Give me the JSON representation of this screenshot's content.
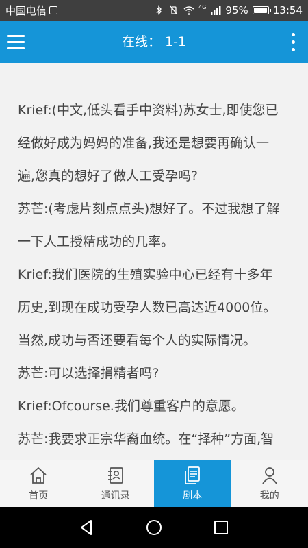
{
  "status_bar": {
    "carrier": "中国电信",
    "network": "4G",
    "battery": "95%",
    "battery_level": 0.95,
    "time": "13:54"
  },
  "app_bar": {
    "title": "在线： 1-1",
    "menu_icon": "hamburger-menu-icon",
    "more_icon": "more-vertical-icon"
  },
  "script": {
    "lines": [
      "Krief:(中文,低头看手中资料)苏女士,即使您已",
      "经做好成为妈妈的准备,我还是想要再确认一",
      "遍,您真的想好了做人工受孕吗?",
      "苏芒:(考虑片刻点点头)想好了。不过我想了解",
      "一下人工授精成功的几率。",
      "Krief:我们医院的生殖实验中心已经有十多年",
      "历史,到现在成功受孕人数已高达近4000位。",
      "当然,成功与否还要看每个人的实际情况。",
      "苏芒:可以选择捐精者吗?",
      "Krief:Ofcourse.我们尊重客户的意愿。",
      "苏芒:我要求正宗华裔血统。在“择种”方面,智"
    ]
  },
  "tabs": [
    {
      "label": "首页",
      "icon": "home-icon",
      "active": false
    },
    {
      "label": "通讯录",
      "icon": "contacts-icon",
      "active": false
    },
    {
      "label": "剧本",
      "icon": "script-document-icon",
      "active": true
    },
    {
      "label": "我的",
      "icon": "profile-icon",
      "active": false
    }
  ],
  "colors": {
    "primary": "#1595d8",
    "status_bar": "#3f3f3f",
    "content_bg": "#f2f2f2",
    "text": "#454545"
  }
}
